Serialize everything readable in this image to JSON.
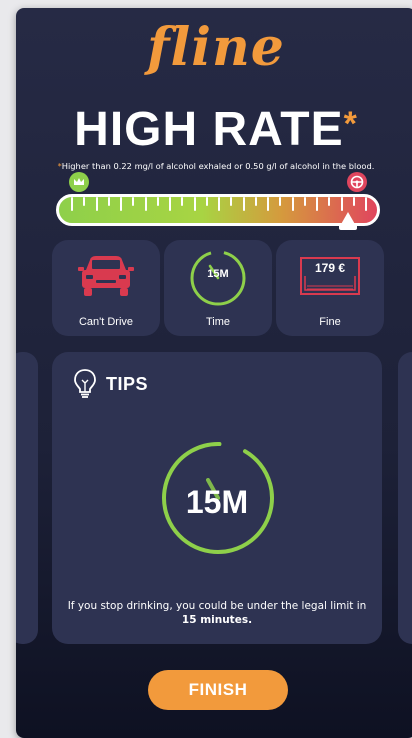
{
  "brand": {
    "logo_text": "fline"
  },
  "header": {
    "title": "HIGH RATE",
    "title_mark": "*",
    "note_mark": "*",
    "note": "Higher than 0.22 mg/l of alcohol exhaled or 0.50 g/l of alcohol in the blood."
  },
  "gauge": {
    "level": 0.9,
    "left_icon": "crown-icon",
    "right_icon": "steering-wheel-icon",
    "colors": {
      "low": "#8ed04a",
      "high": "#e0455e"
    }
  },
  "status_tiles": [
    {
      "label": "Can't Drive",
      "icon": "car-icon"
    },
    {
      "label": "Time",
      "value": "15M",
      "icon": "timer-icon"
    },
    {
      "label": "Fine",
      "value": "179 €",
      "icon": "banknote-icon"
    }
  ],
  "tips": {
    "title": "TIPS",
    "icon": "lightbulb-icon",
    "timer_value": "15M",
    "message_prefix": "If you stop drinking, you could be under the legal limit in ",
    "message_highlight": "15 minutes.",
    "progress": 0.08
  },
  "footer": {
    "finish_label": "FINISH"
  },
  "colors": {
    "accent": "#f29a3c",
    "card_bg": "#262a45",
    "tile_bg": "#2e3352",
    "timer_green": "#8ed04a",
    "car_red": "#d93a4f"
  }
}
